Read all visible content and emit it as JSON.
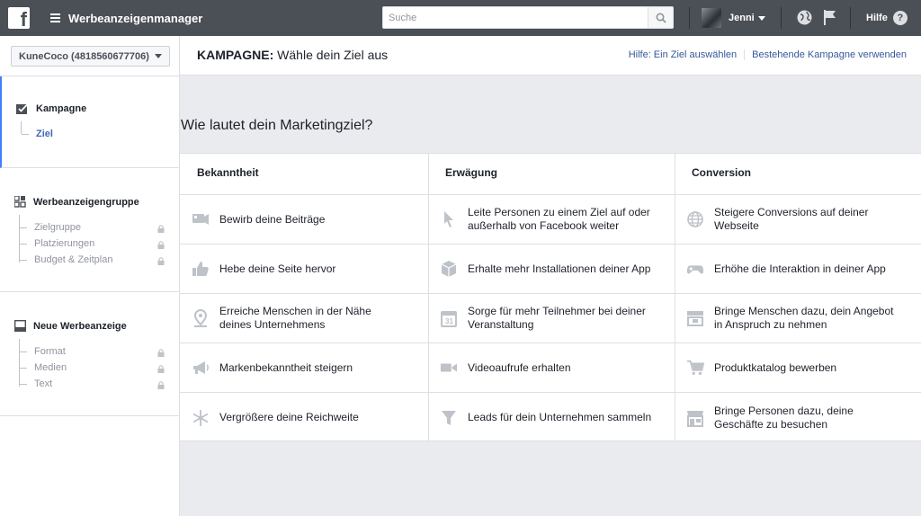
{
  "topbar": {
    "logo": "f",
    "app_title": "Werbeanzeigenmanager",
    "search_placeholder": "Suche",
    "user_name": "Jenni",
    "help_label": "Hilfe",
    "help_glyph": "?"
  },
  "sidebar": {
    "account": "KuneCoco (4818560677706)",
    "steps": [
      {
        "title": "Kampagne",
        "items": [
          {
            "label": "Ziel",
            "active": true,
            "locked": false
          }
        ]
      },
      {
        "title": "Werbeanzeigengruppe",
        "items": [
          {
            "label": "Zielgruppe",
            "locked": true
          },
          {
            "label": "Platzierungen",
            "locked": true
          },
          {
            "label": "Budget & Zeitplan",
            "locked": true
          }
        ]
      },
      {
        "title": "Neue Werbeanzeige",
        "items": [
          {
            "label": "Format",
            "locked": true
          },
          {
            "label": "Medien",
            "locked": true
          },
          {
            "label": "Text",
            "locked": true
          }
        ]
      }
    ]
  },
  "header": {
    "title_bold": "KAMPAGNE:",
    "title_rest": " Wähle dein Ziel aus",
    "link_help": "Hilfe: Ein Ziel auswählen",
    "link_existing": "Bestehende Kampagne verwenden"
  },
  "question": "Wie lautet dein Marketingziel?",
  "columns": [
    {
      "title": "Bekanntheit",
      "items": [
        {
          "icon": "posts-icon",
          "label": "Bewirb deine Beiträge"
        },
        {
          "icon": "thumbs-up-icon",
          "label": "Hebe deine Seite hervor"
        },
        {
          "icon": "map-pin-icon",
          "label": "Erreiche Menschen in der Nähe deines Unternehmens"
        },
        {
          "icon": "megaphone-icon",
          "label": "Markenbekanntheit steigern"
        },
        {
          "icon": "snowflake-icon",
          "label": "Vergrößere deine Reichweite"
        }
      ]
    },
    {
      "title": "Erwägung",
      "items": [
        {
          "icon": "cursor-icon",
          "label": "Leite Personen zu einem Ziel auf oder außerhalb von Facebook weiter"
        },
        {
          "icon": "box-icon",
          "label": "Erhalte mehr Installationen deiner App"
        },
        {
          "icon": "calendar-icon",
          "label": "Sorge für mehr Teilnehmer bei deiner Veranstaltung"
        },
        {
          "icon": "video-camera-icon",
          "label": "Videoaufrufe erhalten"
        },
        {
          "icon": "funnel-icon",
          "label": "Leads für dein Unternehmen sammeln"
        }
      ]
    },
    {
      "title": "Conversion",
      "items": [
        {
          "icon": "globe-icon",
          "label": "Steigere Conversions auf deiner Webseite"
        },
        {
          "icon": "game-controller-icon",
          "label": "Erhöhe die Interaktion in deiner App"
        },
        {
          "icon": "offer-icon",
          "label": "Bringe Menschen dazu, dein Angebot in Anspruch zu nehmen"
        },
        {
          "icon": "shopping-cart-icon",
          "label": "Produktkatalog bewerben"
        },
        {
          "icon": "storefront-icon",
          "label": "Bringe Personen dazu, deine Geschäfte zu besuchen"
        }
      ]
    }
  ],
  "colors": {
    "topbar": "#4b4f56",
    "active_blue": "#4267b2",
    "link_blue": "#365899",
    "icon_gray": "#bec2c9",
    "background": "#e9ebee"
  }
}
